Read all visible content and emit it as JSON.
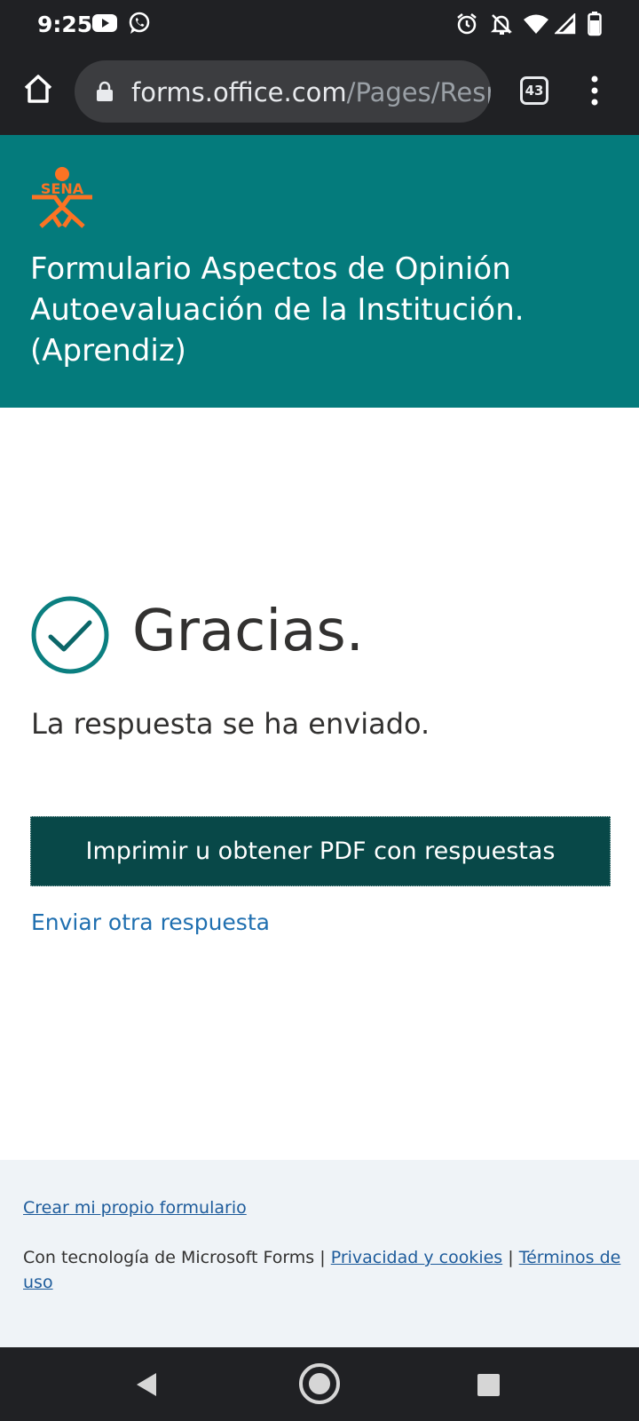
{
  "status_bar": {
    "time": "9:25",
    "left_icons": [
      "youtube-icon",
      "whatsapp-icon"
    ],
    "right_icons": [
      "alarm-icon",
      "notifications-off-icon",
      "wifi-icon",
      "signal-icon",
      "battery-icon"
    ]
  },
  "browser": {
    "url_host": "forms.office.com",
    "url_path": "/Pages/Respo",
    "tab_count": "43"
  },
  "header": {
    "logo_text": "SENA",
    "title": "Formulario Aspectos de Opinión Autoevaluación de la Institución. (Aprendiz)",
    "background_color": "#047b7c",
    "logo_color": "#fc7323"
  },
  "confirmation": {
    "title": "Gracias.",
    "message": "La respuesta se ha enviado.",
    "print_button_label": "Imprimir u obtener PDF con respuestas",
    "another_response_label": "Enviar otra respuesta"
  },
  "footer": {
    "create_form_link": "Crear mi propio formulario",
    "powered_by": "Con tecnología de Microsoft Forms |",
    "privacy_link": "Privacidad y cookies",
    "separator": "|",
    "terms_link": "Términos de uso"
  }
}
